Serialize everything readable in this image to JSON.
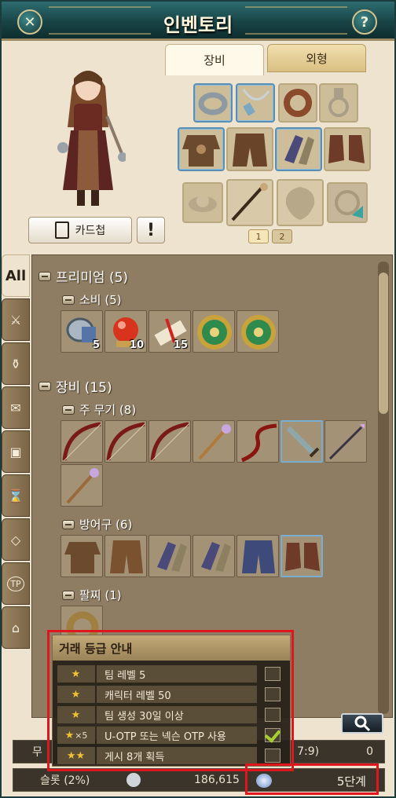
{
  "window": {
    "title": "인벤토리"
  },
  "tabs": [
    {
      "label": "장비"
    },
    {
      "label": "외형"
    }
  ],
  "buttons": {
    "card": "카드첩",
    "exclaim": "!"
  },
  "pages": [
    "1",
    "2"
  ],
  "sidebar": {
    "all_label": "All"
  },
  "categories": {
    "premium": "프리미엄 (5)",
    "consumable": "소비 (5)",
    "equipment": "장비 (15)",
    "main_weapon": "주 무기 (8)",
    "armor": "방어구 (6)",
    "bracelet": "팔찌 (1)"
  },
  "consumable_items": [
    {
      "qty": "5"
    },
    {
      "qty": "10"
    },
    {
      "qty": "15"
    },
    {
      "qty": ""
    },
    {
      "qty": ""
    }
  ],
  "tooltip": {
    "title": "거래 등급 안내",
    "rows": [
      {
        "stars": "★",
        "mult": "",
        "label": "팀 레벨 5",
        "checked": false
      },
      {
        "stars": "★",
        "mult": "",
        "label": "캐릭터 레벨 50",
        "checked": false
      },
      {
        "stars": "★",
        "mult": "",
        "label": "팀 생성 30일 이상",
        "checked": false
      },
      {
        "stars": "★",
        "mult": "×5",
        "label": "U-OTP 또는 넥슨 OTP 사용",
        "checked": true
      },
      {
        "stars": "★★",
        "mult": "",
        "label": "게시 8개 획득",
        "checked": false
      }
    ]
  },
  "bottom": {
    "weight_prefix": "무",
    "weight_fraction": "7:9)",
    "weight_value": "0",
    "slot_label": "슬롯 (2%)",
    "silver": "186,615",
    "trade_level": "5단계"
  }
}
